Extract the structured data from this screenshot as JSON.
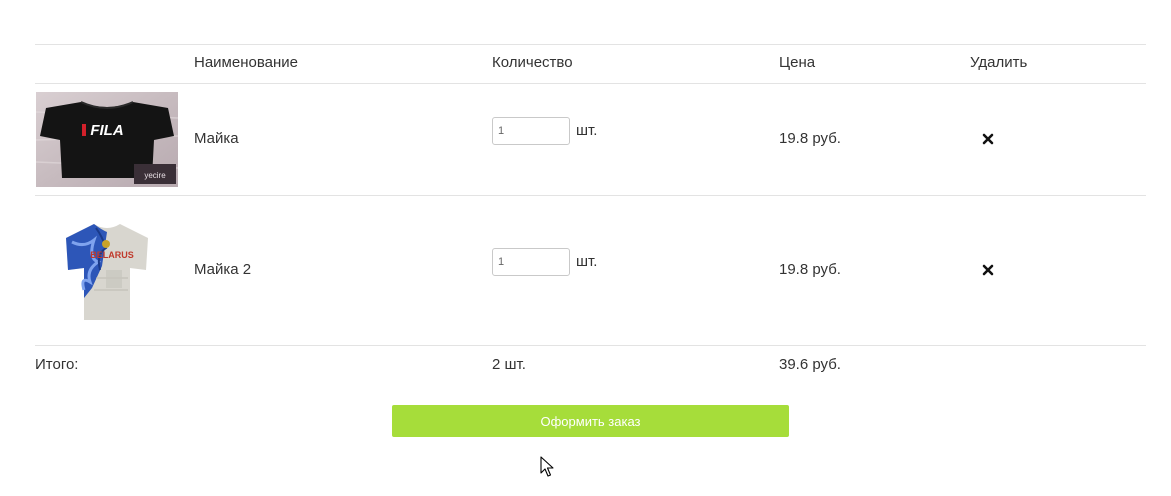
{
  "table": {
    "headers": {
      "name": "Наименование",
      "quantity": "Количество",
      "price": "Цена",
      "delete": "Удалить"
    },
    "rows": [
      {
        "name": "Майка",
        "quantity": "1",
        "unit": "шт.",
        "price": "19.8 руб.",
        "image_brand": "FILA",
        "image_watermark": "yecire",
        "delete_icon": "close-icon"
      },
      {
        "name": "Майка 2",
        "quantity": "1",
        "unit": "шт.",
        "price": "19.8 руб.",
        "image_text": "BELARUS",
        "delete_icon": "close-icon"
      }
    ]
  },
  "total": {
    "label": "Итого:",
    "quantity": "2 шт.",
    "price": "39.6 руб."
  },
  "checkout_button": "Оформить заказ",
  "colors": {
    "checkout": "#a6dd3a",
    "divider": "#e3e3e3",
    "text": "#333333"
  }
}
